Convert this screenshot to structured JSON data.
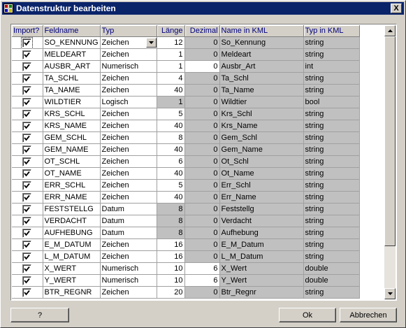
{
  "window": {
    "title": "Datenstruktur bearbeiten",
    "close_label": "X"
  },
  "grid": {
    "columns": [
      "Import?",
      "Feldname",
      "Typ",
      "Länge",
      "Dezimal",
      "Name in KML",
      "Typ in KML"
    ],
    "rows": [
      {
        "import": true,
        "feldname": "SO_KENNUNG",
        "typ": "Zeichen",
        "laenge": "12",
        "dezimal": "0",
        "kml_name": "So_Kennung",
        "kml_typ": "string"
      },
      {
        "import": true,
        "feldname": "MELDEART",
        "typ": "Zeichen",
        "laenge": "1",
        "dezimal": "0",
        "kml_name": "Meldeart",
        "kml_typ": "string"
      },
      {
        "import": true,
        "feldname": "AUSBR_ART",
        "typ": "Numerisch",
        "laenge": "1",
        "dezimal": "0",
        "kml_name": "Ausbr_Art",
        "kml_typ": "int"
      },
      {
        "import": true,
        "feldname": "TA_SCHL",
        "typ": "Zeichen",
        "laenge": "4",
        "dezimal": "0",
        "kml_name": "Ta_Schl",
        "kml_typ": "string"
      },
      {
        "import": true,
        "feldname": "TA_NAME",
        "typ": "Zeichen",
        "laenge": "40",
        "dezimal": "0",
        "kml_name": "Ta_Name",
        "kml_typ": "string"
      },
      {
        "import": true,
        "feldname": "WILDTIER",
        "typ": "Logisch",
        "laenge": "1",
        "dezimal": "0",
        "kml_name": "Wildtier",
        "kml_typ": "bool"
      },
      {
        "import": true,
        "feldname": "KRS_SCHL",
        "typ": "Zeichen",
        "laenge": "5",
        "dezimal": "0",
        "kml_name": "Krs_Schl",
        "kml_typ": "string"
      },
      {
        "import": true,
        "feldname": "KRS_NAME",
        "typ": "Zeichen",
        "laenge": "40",
        "dezimal": "0",
        "kml_name": "Krs_Name",
        "kml_typ": "string"
      },
      {
        "import": true,
        "feldname": "GEM_SCHL",
        "typ": "Zeichen",
        "laenge": "8",
        "dezimal": "0",
        "kml_name": "Gem_Schl",
        "kml_typ": "string"
      },
      {
        "import": true,
        "feldname": "GEM_NAME",
        "typ": "Zeichen",
        "laenge": "40",
        "dezimal": "0",
        "kml_name": "Gem_Name",
        "kml_typ": "string"
      },
      {
        "import": true,
        "feldname": "OT_SCHL",
        "typ": "Zeichen",
        "laenge": "6",
        "dezimal": "0",
        "kml_name": "Ot_Schl",
        "kml_typ": "string"
      },
      {
        "import": true,
        "feldname": "OT_NAME",
        "typ": "Zeichen",
        "laenge": "40",
        "dezimal": "0",
        "kml_name": "Ot_Name",
        "kml_typ": "string"
      },
      {
        "import": true,
        "feldname": "ERR_SCHL",
        "typ": "Zeichen",
        "laenge": "5",
        "dezimal": "0",
        "kml_name": "Err_Schl",
        "kml_typ": "string"
      },
      {
        "import": true,
        "feldname": "ERR_NAME",
        "typ": "Zeichen",
        "laenge": "40",
        "dezimal": "0",
        "kml_name": "Err_Name",
        "kml_typ": "string"
      },
      {
        "import": true,
        "feldname": "FESTSTELLG",
        "typ": "Datum",
        "laenge": "8",
        "dezimal": "0",
        "kml_name": "Feststellg",
        "kml_typ": "string"
      },
      {
        "import": true,
        "feldname": "VERDACHT",
        "typ": "Datum",
        "laenge": "8",
        "dezimal": "0",
        "kml_name": "Verdacht",
        "kml_typ": "string"
      },
      {
        "import": true,
        "feldname": "AUFHEBUNG",
        "typ": "Datum",
        "laenge": "8",
        "dezimal": "0",
        "kml_name": "Aufhebung",
        "kml_typ": "string"
      },
      {
        "import": true,
        "feldname": "E_M_DATUM",
        "typ": "Zeichen",
        "laenge": "16",
        "dezimal": "0",
        "kml_name": "E_M_Datum",
        "kml_typ": "string"
      },
      {
        "import": true,
        "feldname": "L_M_DATUM",
        "typ": "Zeichen",
        "laenge": "16",
        "dezimal": "0",
        "kml_name": "L_M_Datum",
        "kml_typ": "string"
      },
      {
        "import": true,
        "feldname": "X_WERT",
        "typ": "Numerisch",
        "laenge": "10",
        "dezimal": "6",
        "kml_name": "X_Wert",
        "kml_typ": "double"
      },
      {
        "import": true,
        "feldname": "Y_WERT",
        "typ": "Numerisch",
        "laenge": "10",
        "dezimal": "6",
        "kml_name": "Y_Wert",
        "kml_typ": "double"
      },
      {
        "import": true,
        "feldname": "BTR_REGNR",
        "typ": "Zeichen",
        "laenge": "20",
        "dezimal": "0",
        "kml_name": "Btr_Regnr",
        "kml_typ": "string"
      }
    ]
  },
  "buttons": {
    "help_label": "?",
    "ok_label": "Ok",
    "cancel_label": "Abbrechen"
  },
  "colors": {
    "titlebar": "#0a246a",
    "face": "#d4d0c8",
    "readonly_cell": "#c0c0c0",
    "header_text": "#00007f"
  }
}
